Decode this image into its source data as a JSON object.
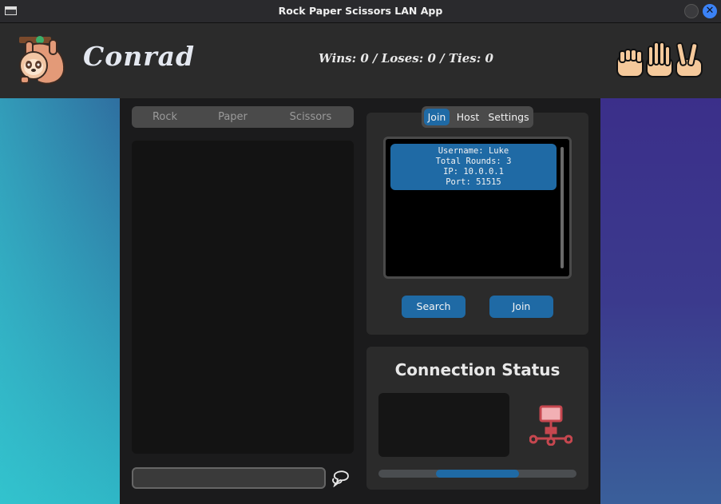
{
  "window": {
    "title": "Rock Paper Scissors LAN App"
  },
  "header": {
    "app_name": "Conrad",
    "score": "Wins: 0 / Loses: 0 / Ties: 0"
  },
  "moves": [
    "Rock",
    "Paper",
    "Scissors"
  ],
  "chat": {
    "input_value": "",
    "input_placeholder": ""
  },
  "join_panel": {
    "tabs": [
      "Join",
      "Host",
      "Settings"
    ],
    "active_tab": "Join",
    "servers": [
      {
        "line1": "Username: Luke",
        "line2": "Total Rounds: 3",
        "line3": "IP: 10.0.0.1",
        "line4": "Port: 51515"
      }
    ],
    "search_label": "Search",
    "join_label": "Join"
  },
  "status": {
    "title": "Connection Status",
    "progress_start": 0.29,
    "progress_end": 0.71
  },
  "colors": {
    "accent": "#1f6aa5",
    "gradient_left_top": "#2f6fa0",
    "gradient_left_bottom": "#2fb7c6",
    "gradient_right": "#3b2f8a",
    "network_icon": "#c6474f"
  }
}
